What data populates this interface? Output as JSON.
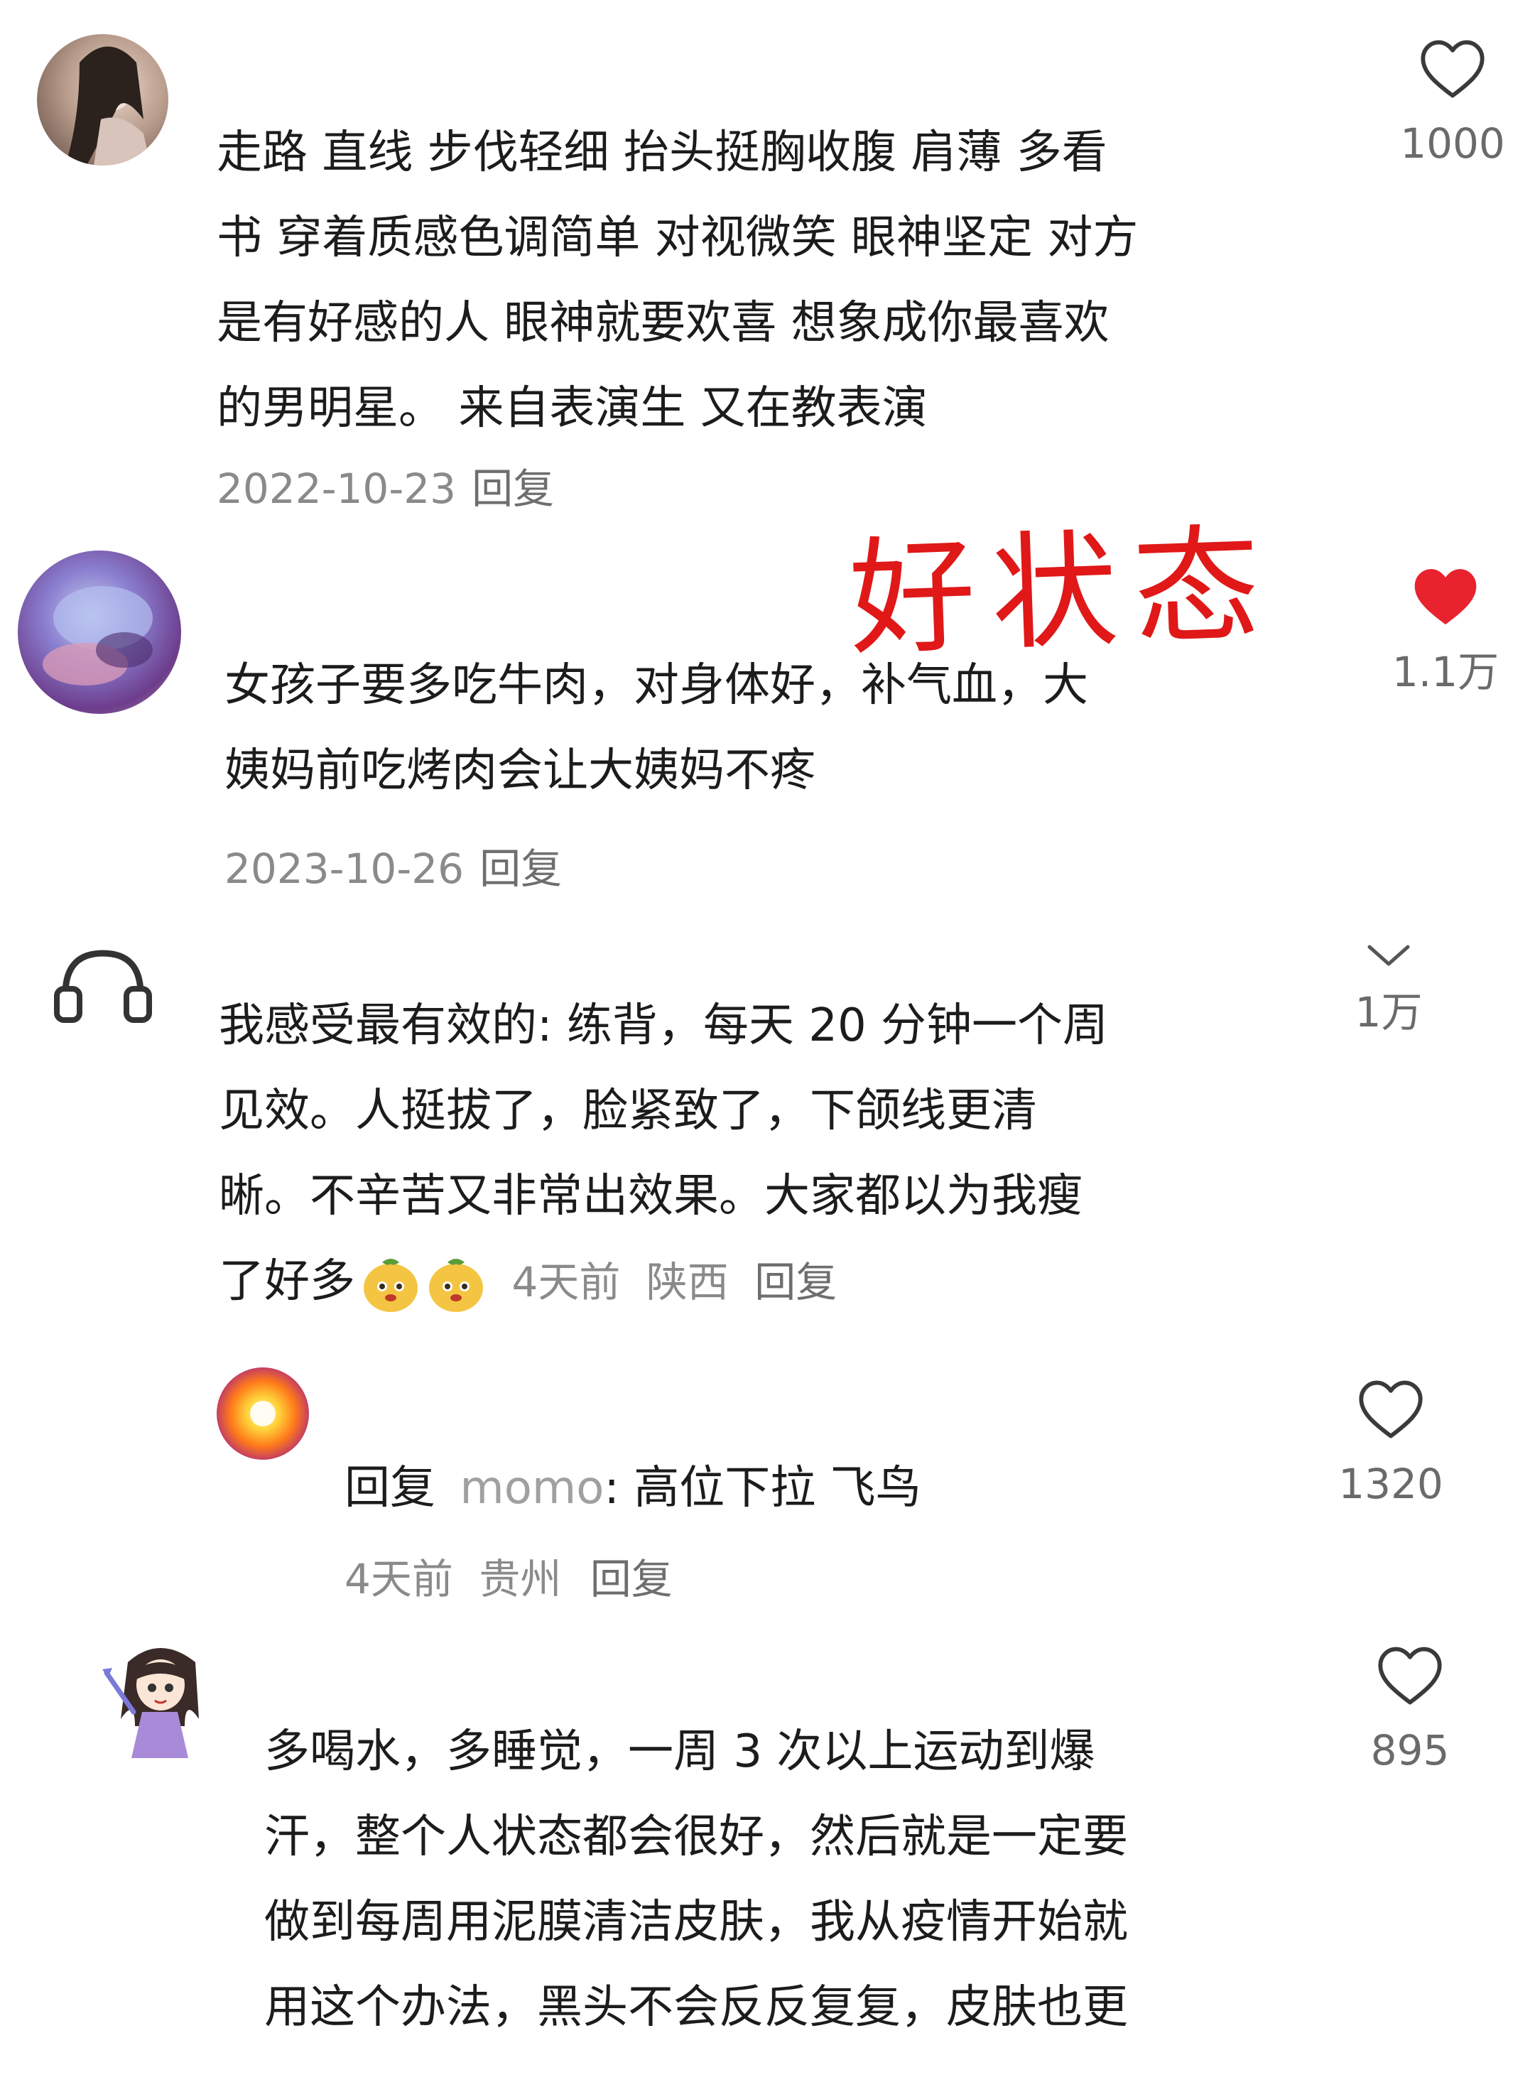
{
  "overlay": {
    "title": "好状态",
    "color": "#e01818"
  },
  "comments": [
    {
      "lines": [
        "走路 直线  步伐轻细 抬头挺胸收腹 肩薄  多看",
        "书 穿着质感色调简单  对视微笑 眼神坚定 对方",
        "是有好感的人 眼神就要欢喜  想象成你最喜欢",
        "的男明星。 来自表演生 又在教表演"
      ],
      "date": "2022-10-23",
      "reply_label": "回复",
      "likes": "1000",
      "like_icon": "heart-outline-icon"
    },
    {
      "lines": [
        "女孩子要多吃牛肉，对身体好，补气血，大",
        "姨妈前吃烤肉会让大姨妈不疼"
      ],
      "date": "2023-10-26",
      "reply_label": "回复",
      "likes": "1.1万",
      "like_icon": "heart-filled-icon",
      "like_color": "#e8232e"
    },
    {
      "lines": [
        "我感受最有效的: 练背，每天 20 分钟一个周",
        "见效。人挺拔了，脸紧致了，下颌线更清",
        "晰。不辛苦又非常出效果。大家都以为我瘦",
        "了好多"
      ],
      "time": "4天前",
      "location": "陕西",
      "reply_label": "回复",
      "likes": "1万",
      "like_icon": "chevron-down-icon"
    },
    {
      "reply_prefix": "回复",
      "reply_user": "momo",
      "text": ": 高位下拉 飞鸟",
      "time": "4天前",
      "location": "贵州",
      "reply_label": "回复",
      "likes": "1320",
      "like_icon": "heart-outline-icon"
    },
    {
      "lines": [
        "多喝水，多睡觉，一周 3 次以上运动到爆",
        "汗，整个人状态都会很好，然后就是一定要",
        "做到每周用泥膜清洁皮肤，我从疫情开始就",
        "用这个办法，黑头不会反反复复，皮肤也更"
      ],
      "likes": "895",
      "like_icon": "heart-outline-icon"
    }
  ]
}
